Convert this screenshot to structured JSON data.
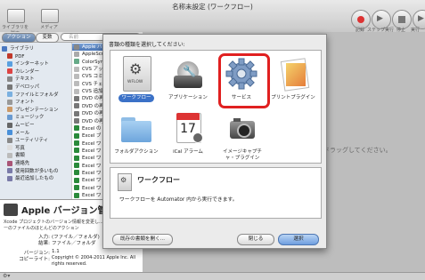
{
  "window": {
    "title": "名称未設定 (ワークフロー)"
  },
  "toolbar": {
    "left": [
      {
        "label": "ライブラリを隠す"
      },
      {
        "label": "メディア"
      }
    ],
    "right": [
      {
        "label": "記録"
      },
      {
        "label": "ステップ実行"
      },
      {
        "label": "停止"
      },
      {
        "label": "実行"
      }
    ]
  },
  "library": {
    "tabs": [
      {
        "label": "アクション"
      },
      {
        "label": "変数"
      }
    ],
    "search_placeholder": "名前",
    "items": [
      {
        "label": "ライブラリ",
        "color": "#4a78c0"
      },
      {
        "label": "PDF",
        "color": "#c0392b"
      },
      {
        "label": "インターネット",
        "color": "#5aa0e0"
      },
      {
        "label": "カレンダー",
        "color": "#d44"
      },
      {
        "label": "テキスト",
        "color": "#888"
      },
      {
        "label": "デベロッパ",
        "color": "#777"
      },
      {
        "label": "ファイルとフォルダ",
        "color": "#7ab0e0"
      },
      {
        "label": "フォント",
        "color": "#999"
      },
      {
        "label": "プレゼンテーション",
        "color": "#c96"
      },
      {
        "label": "ミュージック",
        "color": "#6a9ad0"
      },
      {
        "label": "ムービー",
        "color": "#666"
      },
      {
        "label": "メール",
        "color": "#4a90d9"
      },
      {
        "label": "ユーティリティ",
        "color": "#888"
      },
      {
        "label": "写真",
        "color": "#ddd"
      },
      {
        "label": "書類",
        "color": "#bbb"
      },
      {
        "label": "連絡先",
        "color": "#a57"
      },
      {
        "label": "使用回数が多いもの",
        "color": "#7a7aa8"
      },
      {
        "label": "最近追加したもの",
        "color": "#7a7aa8"
      }
    ]
  },
  "actions": {
    "items": [
      {
        "label": "Apple バー",
        "color": "#888"
      },
      {
        "label": "AppleScript",
        "color": "#aaa"
      },
      {
        "label": "ColorSync",
        "color": "#6a8"
      },
      {
        "label": "CVS アップ",
        "color": "#bbb"
      },
      {
        "label": "CVS コミッ",
        "color": "#bbb"
      },
      {
        "label": "CVS チェッ",
        "color": "#bbb"
      },
      {
        "label": "CVS 追加",
        "color": "#bbb"
      },
      {
        "label": "DVD の再生",
        "color": "#777"
      },
      {
        "label": "DVD の再生",
        "color": "#777"
      },
      {
        "label": "DVD の再生",
        "color": "#777"
      },
      {
        "label": "DVD の再生",
        "color": "#777"
      },
      {
        "label": "Excel の",
        "color": "#2a8a3a"
      },
      {
        "label": "Excel ブ",
        "color": "#2a8a3a"
      },
      {
        "label": "Excel ワ",
        "color": "#2a8a3a"
      },
      {
        "label": "Excel ワ",
        "color": "#2a8a3a"
      },
      {
        "label": "Excel ワ",
        "color": "#2a8a3a"
      },
      {
        "label": "Excel ワ",
        "color": "#2a8a3a"
      },
      {
        "label": "Excel ワ",
        "color": "#2a8a3a"
      },
      {
        "label": "Excel ワ",
        "color": "#2a8a3a"
      },
      {
        "label": "Excel ワ",
        "color": "#2a8a3a"
      },
      {
        "label": "Excel ワ",
        "color": "#2a8a3a"
      }
    ]
  },
  "info": {
    "title": "Apple バージョン管理",
    "description": "Xcode プロジェクトのバージョン情報を変更し... ルを使用し、ネーのファイルのほとんどのアクション",
    "input_label": "入力:",
    "input_value": "(ファイル／フォルダ)",
    "result_label": "結果:",
    "result_value": "ファイル／フォルダ",
    "version_label": "バージョン:",
    "version_value": "1.1",
    "copyright_label": "コピーライト:",
    "copyright_value": "Copyright © 2004-2011 Apple Inc. All rights reserved."
  },
  "workarea": {
    "drop_hint": "ァイルをドラッグしてください。"
  },
  "dialog": {
    "heading": "書類の種類を選択してください:",
    "types": [
      {
        "label": "ワークフロー",
        "icon": "workflow-icon",
        "selected": true
      },
      {
        "label": "アプリケーション",
        "icon": "application-icon",
        "selected": false
      },
      {
        "label": "サービス",
        "icon": "service-gear-icon",
        "selected": false,
        "highlight": "#e02020"
      },
      {
        "label": "プリントプラグイン",
        "icon": "print-plugin-icon",
        "selected": false
      },
      {
        "label": "フォルダアクション",
        "icon": "folder-action-icon",
        "selected": false
      },
      {
        "label": "iCal アラーム",
        "icon": "ical-alarm-icon",
        "selected": false,
        "day": "17"
      },
      {
        "label": "イメージキャプチャ・プラグイン",
        "icon": "image-capture-icon",
        "selected": false
      }
    ],
    "detail": {
      "title": "ワークフロー",
      "text": "ワークフローを Automator 内から実行できます。"
    },
    "open_existing": "既存の書類を開く...",
    "close": "閉じる",
    "choose": "選択"
  }
}
